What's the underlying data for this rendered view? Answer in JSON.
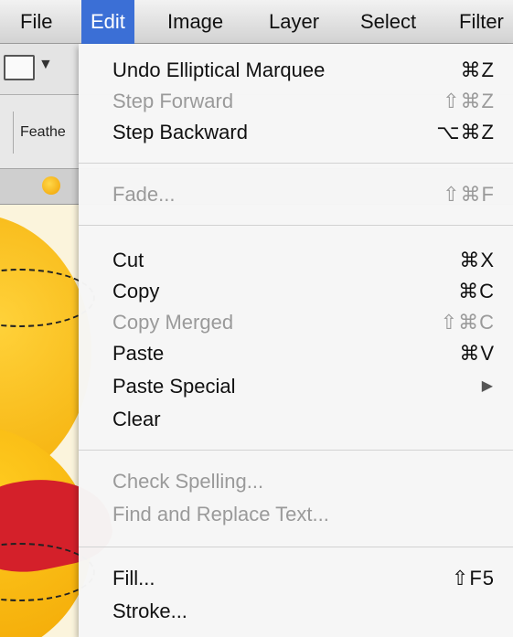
{
  "menubar": {
    "items": [
      {
        "label": "File"
      },
      {
        "label": "Edit"
      },
      {
        "label": "Image"
      },
      {
        "label": "Layer"
      },
      {
        "label": "Select"
      },
      {
        "label": "Filter"
      }
    ],
    "active": "Edit"
  },
  "background": {
    "feather_label": "Feathe"
  },
  "menu": {
    "items": [
      {
        "label": "Undo Elliptical Marquee",
        "shortcut": "⌘Z",
        "enabled": true
      },
      {
        "label": "Step Forward",
        "shortcut": "⇧⌘Z",
        "enabled": false
      },
      {
        "label": "Step Backward",
        "shortcut": "⌥⌘Z",
        "enabled": true
      },
      {
        "label": "Fade...",
        "shortcut": "⇧⌘F",
        "enabled": false
      },
      {
        "label": "Cut",
        "shortcut": "⌘X",
        "enabled": true
      },
      {
        "label": "Copy",
        "shortcut": "⌘C",
        "enabled": true
      },
      {
        "label": "Copy Merged",
        "shortcut": "⇧⌘C",
        "enabled": false
      },
      {
        "label": "Paste",
        "shortcut": "⌘V",
        "enabled": true
      },
      {
        "label": "Paste Special",
        "submenu_icon": "triangle-right-icon",
        "enabled": true
      },
      {
        "label": "Clear",
        "shortcut": "",
        "enabled": true
      },
      {
        "label": "Check Spelling...",
        "shortcut": "",
        "enabled": false
      },
      {
        "label": "Find and Replace Text...",
        "shortcut": "",
        "enabled": false
      },
      {
        "label": "Fill...",
        "shortcut": "⇧F5",
        "enabled": true
      },
      {
        "label": "Stroke...",
        "shortcut": "",
        "enabled": true
      }
    ]
  },
  "colors": {
    "menu_highlight": "#3b6fd6",
    "disabled_text": "#9a9a9a",
    "canvas_yellow": "#f2a800",
    "canvas_red": "#d4202a"
  }
}
